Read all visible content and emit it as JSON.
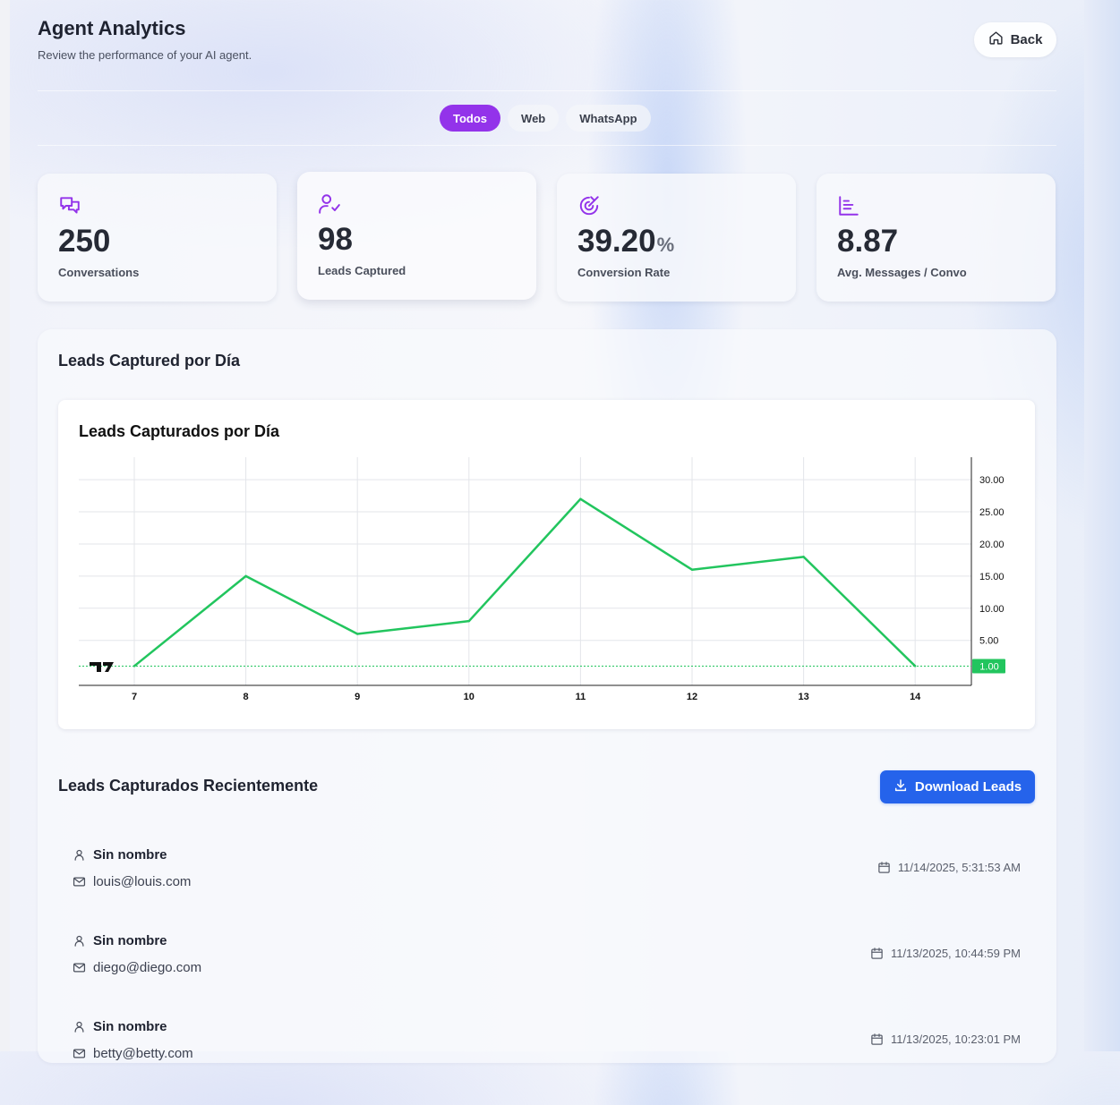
{
  "header": {
    "title": "Agent Analytics",
    "subtitle": "Review the performance of your AI agent.",
    "back_label": "Back"
  },
  "tabs": [
    {
      "label": "Todos",
      "active": true
    },
    {
      "label": "Web",
      "active": false
    },
    {
      "label": "WhatsApp",
      "active": false
    }
  ],
  "stats": [
    {
      "icon": "chat-bubbles-icon",
      "value": "250",
      "unit": "",
      "label": "Conversations"
    },
    {
      "icon": "user-check-icon",
      "value": "98",
      "unit": "",
      "label": "Leads Captured"
    },
    {
      "icon": "target-arrow-icon",
      "value": "39.20",
      "unit": "%",
      "label": "Conversion Rate"
    },
    {
      "icon": "bar-chart-icon",
      "value": "8.87",
      "unit": "",
      "label": "Avg. Messages / Convo"
    }
  ],
  "section_title": "Leads Captured por Día",
  "chart_data": {
    "type": "line",
    "title": "Leads Capturados por Día",
    "x": [
      "7",
      "8",
      "9",
      "10",
      "11",
      "12",
      "13",
      "14"
    ],
    "values": [
      1,
      15,
      6,
      8,
      27,
      16,
      18,
      1
    ],
    "y_ticks": [
      "5.00",
      "10.00",
      "15.00",
      "20.00",
      "25.00",
      "30.00"
    ],
    "last_value_label": "1.00",
    "ylim": [
      -2,
      33.5
    ],
    "color": "#22c55e",
    "grid": true,
    "y_axis_position": "right"
  },
  "recent": {
    "title": "Leads Capturados Recientemente",
    "download_label": "Download Leads",
    "leads": [
      {
        "name": "Sin nombre",
        "email": "louis@louis.com",
        "date": "11/14/2025, 5:31:53 AM"
      },
      {
        "name": "Sin nombre",
        "email": "diego@diego.com",
        "date": "11/13/2025, 10:44:59 PM"
      },
      {
        "name": "Sin nombre",
        "email": "betty@betty.com",
        "date": "11/13/2025, 10:23:01 PM"
      }
    ]
  },
  "colors": {
    "accent_purple": "#9333ea",
    "button_blue": "#2563eb",
    "line_green": "#22c55e"
  }
}
